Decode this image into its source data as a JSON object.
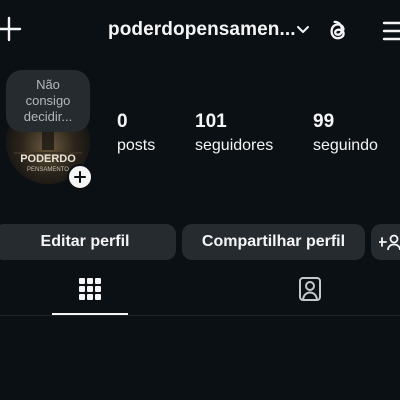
{
  "header": {
    "username": "poderdopensamen...",
    "icons": [
      "plus-icon",
      "chevron-down-icon",
      "threads-icon",
      "hamburger-menu-icon"
    ]
  },
  "profile": {
    "note_text": [
      "Não",
      "consigo",
      "decidir..."
    ],
    "avatar_text_line1": "PODERDO",
    "avatar_text_line2": "PENSAMENTO"
  },
  "stats": [
    {
      "value": "0",
      "label": "posts"
    },
    {
      "value": "101",
      "label": "seguidores"
    },
    {
      "value": "99",
      "label": "seguindo"
    }
  ],
  "actions": {
    "edit_label": "Editar perfil",
    "share_label": "Compartilhar perfil"
  },
  "tabs": {
    "items": [
      "grid-icon",
      "tagged-icon"
    ],
    "active": "grid-icon"
  },
  "colors": {
    "background": "#0b1014",
    "button": "#262b30",
    "text": "#f5f5f5"
  }
}
